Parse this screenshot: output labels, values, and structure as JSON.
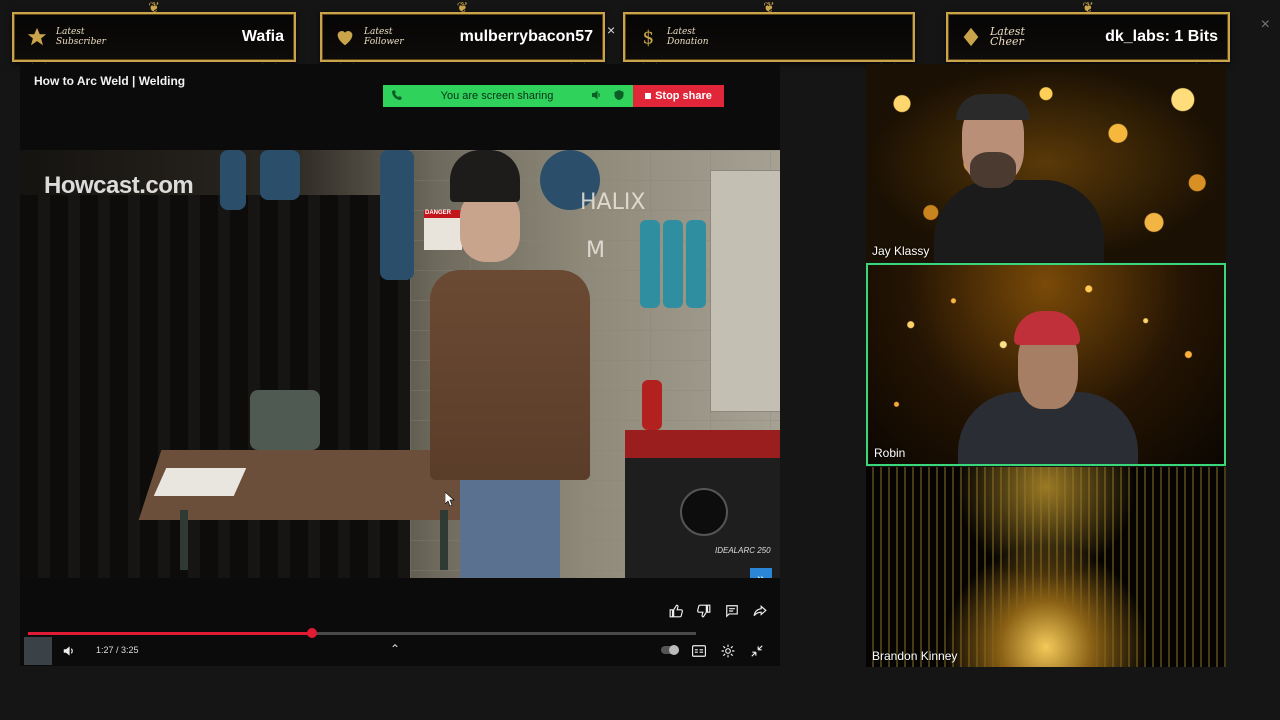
{
  "alerts": [
    {
      "caption": "Latest Subscriber",
      "value": "Wafia"
    },
    {
      "caption": "Latest Follower",
      "value": "mulberrybacon57"
    },
    {
      "caption": "Latest Donation",
      "value": ""
    },
    {
      "caption": "Latest Cheer",
      "value": "dk_labs: 1 Bits"
    }
  ],
  "alert_close": "×",
  "window_close": "×",
  "video": {
    "title": "How to Arc Weld | Welding",
    "watermark": "Howcast.com",
    "sign_text": "DANGER",
    "machine_label": "IDEALARC 250",
    "chalk_text": "HALIX",
    "chalk_text2": "M",
    "time": "1:27 / 3:25",
    "progress": 0.425
  },
  "screen_share": {
    "status": "You are screen sharing",
    "stop_label": "Stop share"
  },
  "participants": [
    {
      "name": "Jay Klassy",
      "active": false
    },
    {
      "name": "Robin",
      "active": true
    },
    {
      "name": "Brandon Kinney",
      "active": false
    }
  ],
  "colors": {
    "gold": "#c9a44a",
    "share_green": "#2fd35b",
    "stop_red": "#e1263a",
    "progress_red": "#e01b33",
    "active_border": "#3ad67a"
  }
}
